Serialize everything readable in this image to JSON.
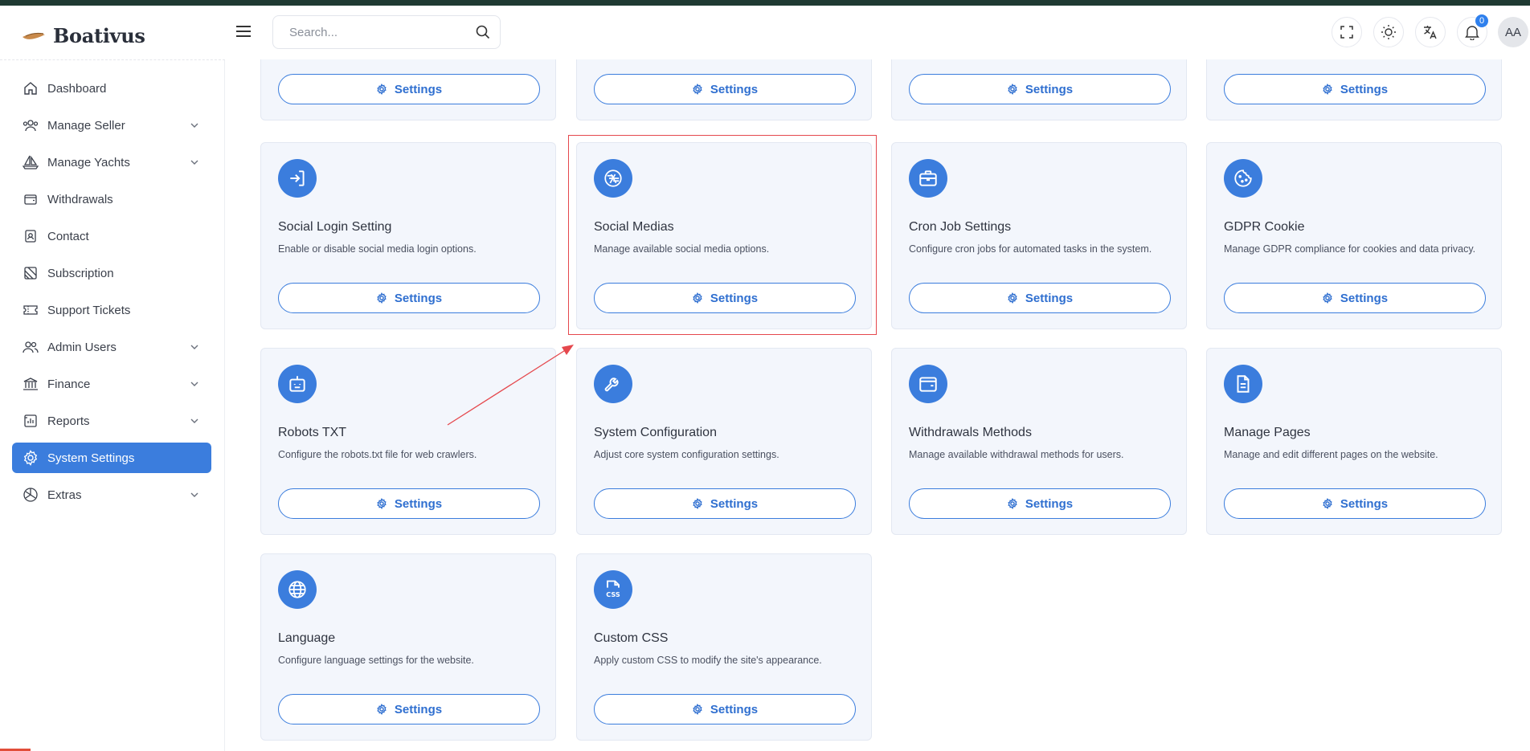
{
  "app": {
    "logo_text": "Boativus"
  },
  "header": {
    "search_placeholder": "Search...",
    "notification_count": "0",
    "avatar_initials": "AA"
  },
  "sidebar": {
    "items": [
      {
        "label": "Dashboard",
        "icon": "home-icon",
        "expandable": false,
        "active": false
      },
      {
        "label": "Manage Seller",
        "icon": "users-icon",
        "expandable": true,
        "active": false
      },
      {
        "label": "Manage Yachts",
        "icon": "sailboat-icon",
        "expandable": true,
        "active": false
      },
      {
        "label": "Withdrawals",
        "icon": "wallet-icon",
        "expandable": false,
        "active": false
      },
      {
        "label": "Contact",
        "icon": "contact-icon",
        "expandable": false,
        "active": false
      },
      {
        "label": "Subscription",
        "icon": "subscription-icon",
        "expandable": false,
        "active": false
      },
      {
        "label": "Support Tickets",
        "icon": "ticket-icon",
        "expandable": false,
        "active": false
      },
      {
        "label": "Admin Users",
        "icon": "admin-users-icon",
        "expandable": true,
        "active": false
      },
      {
        "label": "Finance",
        "icon": "bank-icon",
        "expandable": true,
        "active": false
      },
      {
        "label": "Reports",
        "icon": "report-icon",
        "expandable": true,
        "active": false
      },
      {
        "label": "System Settings",
        "icon": "gear-icon",
        "expandable": false,
        "active": true
      },
      {
        "label": "Extras",
        "icon": "extras-icon",
        "expandable": true,
        "active": false
      }
    ]
  },
  "cards": {
    "button_label": "Settings",
    "top_row_count": 4,
    "items": [
      {
        "title": "Social Login Setting",
        "description": "Enable or disable social media login options.",
        "icon": "login-icon"
      },
      {
        "title": "Social Medias",
        "description": "Manage available social media options.",
        "icon": "aperture-icon"
      },
      {
        "title": "Cron Job Settings",
        "description": "Configure cron jobs for automated tasks in the system.",
        "icon": "briefcase-icon"
      },
      {
        "title": "GDPR Cookie",
        "description": "Manage GDPR compliance for cookies and data privacy.",
        "icon": "cookie-icon"
      },
      {
        "title": "Robots TXT",
        "description": "Configure the robots.txt file for web crawlers.",
        "icon": "robot-icon"
      },
      {
        "title": "System Configuration",
        "description": "Adjust core system configuration settings.",
        "icon": "wrench-icon"
      },
      {
        "title": "Withdrawals Methods",
        "description": "Manage available withdrawal methods for users.",
        "icon": "wallet-icon"
      },
      {
        "title": "Manage Pages",
        "description": "Manage and edit different pages on the website.",
        "icon": "document-icon"
      },
      {
        "title": "Language",
        "description": "Configure language settings for the website.",
        "icon": "globe-icon"
      },
      {
        "title": "Custom CSS",
        "description": "Apply custom CSS to modify the site's appearance.",
        "icon": "css-file-icon"
      }
    ]
  },
  "annotation": {
    "highlighted_card": "Social Medias",
    "color": "#e5484d"
  },
  "colors": {
    "accent": "#3b7ddd",
    "card_bg": "#f3f6fc",
    "top_strip": "#1f3a32"
  }
}
